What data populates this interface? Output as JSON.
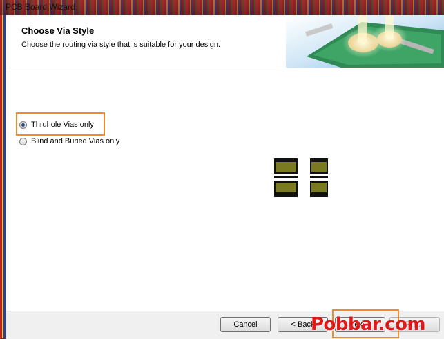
{
  "window": {
    "title": "PCB Board Wizard"
  },
  "header": {
    "title": "Choose Via Style",
    "subtitle": "Choose  the routing via style that is suitable for your design."
  },
  "options": [
    {
      "label": "Thruhole Vias only",
      "checked": true
    },
    {
      "label": "Blind and Buried Vias only",
      "checked": false
    }
  ],
  "buttons": {
    "cancel": "Cancel",
    "back": "< Back",
    "next": "Next >",
    "finish": "Finish"
  },
  "watermark": "Pobbar.com",
  "colors": {
    "highlight": "#f08a2a",
    "via_copper": "#7a7a20",
    "watermark": "#e01818"
  }
}
